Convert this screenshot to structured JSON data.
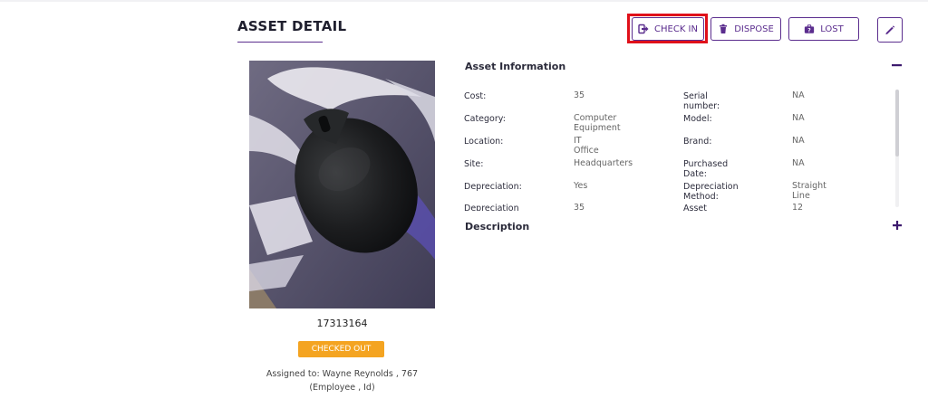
{
  "header": {
    "title": "ASSET DETAIL",
    "buttons": {
      "check_in": "CHECK IN",
      "dispose": "DISPOSE",
      "lost": "LOST"
    }
  },
  "asset": {
    "id": "17313164",
    "status": "CHECKED OUT",
    "assigned_line1": "Assigned to: Wayne Reynolds , 767",
    "assigned_line2": "(Employee , Id)"
  },
  "asset_information": {
    "title": "Asset Information",
    "rows": [
      {
        "label1": "Cost:",
        "value1": "35",
        "label2": "Serial number:",
        "value2": "NA"
      },
      {
        "label1": "Category:",
        "value1": "Computer Equipment",
        "label2": "Model:",
        "value2": "NA"
      },
      {
        "label1": "Location:",
        "value1": "IT Office",
        "label2": "Brand:",
        "value2": "NA"
      },
      {
        "label1": "Site:",
        "value1": "Headquarters",
        "label2": "Purchased Date:",
        "value2": "NA"
      },
      {
        "label1": "Depreciation:",
        "value1": "Yes",
        "label2": "Depreciation Method:",
        "value2": "Straight Line"
      },
      {
        "label1": "Depreciation",
        "value1": "35",
        "label2": "Asset Life(Month):",
        "value2": "12"
      }
    ]
  },
  "description": {
    "title": "Description"
  },
  "colors": {
    "accent": "#5b2d8e",
    "highlight": "#e0101a",
    "status": "#f4a421"
  },
  "icons": [
    "check-in-icon",
    "trash-icon",
    "lost-bag-icon",
    "pencil-icon",
    "minus-icon",
    "plus-icon"
  ]
}
